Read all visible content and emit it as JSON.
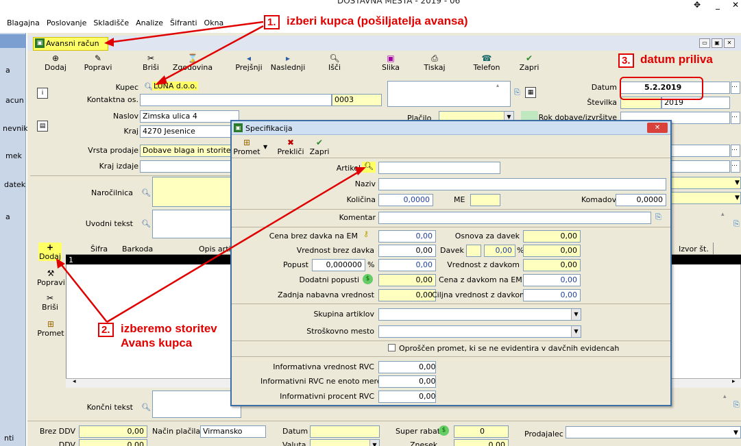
{
  "window_title": "DOSTAVNA MESTA - 2019 - 06",
  "menu": [
    "Blagajna",
    "Poslovanje",
    "Skladišče",
    "Analize",
    "Šifranti",
    "Okna"
  ],
  "left_sidebar": [
    "a",
    "acun",
    "nevnik",
    "mek",
    "datek",
    "a",
    "nti"
  ],
  "doc_title": "Avansni račun",
  "toolbar": [
    "Dodaj",
    "Popravi",
    "Briši",
    "Zgodovina",
    "Prejšnji",
    "Naslednji",
    "Išči",
    "Slika",
    "Tiskaj",
    "Telefon",
    "Zapri"
  ],
  "header": {
    "kupec_label": "Kupec",
    "kupec_value": "LUNA d.o.o.",
    "kontakt_label": "Kontaktna os.",
    "kontakt_code": "0003",
    "naslov_label": "Naslov",
    "naslov_value": "Zimska ulica 4",
    "kraj_label": "Kraj",
    "kraj_value": "4270 Jesenice",
    "vrsta_label": "Vrsta prodaje",
    "vrsta_value": "Dobave blaga in storitev",
    "kraj_izdaje_label": "Kraj izdaje",
    "narocilnica_label": "Naročilnica",
    "uvodni_label": "Uvodni tekst",
    "placilo_label": "Plačilo",
    "datum_label": "Datum",
    "datum_value": "5.2.2019",
    "stevilka_label": "Številka",
    "stevilka_value": "2019",
    "rok_label": "Rok dobave/izvršitve"
  },
  "grid": {
    "columns": [
      "Šifra",
      "Barkoda",
      "Opis arti",
      "Izvor št."
    ],
    "row_num": "1"
  },
  "side_buttons": [
    "Dodaj",
    "Popravi",
    "Briši",
    "Promet"
  ],
  "footer": {
    "koncni_label": "Končni tekst",
    "brez_ddv_label": "Brez DDV",
    "brez_ddv_value": "0,00",
    "ddv_label": "DDV",
    "ddv_value": "0,00",
    "nacin_label": "Način plačila",
    "nacin_value": "Virmansko",
    "datum_label": "Datum",
    "valuta_label": "Valuta",
    "super_label": "Super rabat",
    "super_value": "0",
    "znesek_label": "Znesek",
    "znesek_value": "0,00",
    "prodajalec_label": "Prodajalec"
  },
  "dialog": {
    "title": "Specifikacija",
    "toolbar": [
      "Promet",
      "Prekliči",
      "Zapri"
    ],
    "artikel_label": "Artikel",
    "naziv_label": "Naziv",
    "kolicina_label": "Količina",
    "kolicina_value": "0,0000",
    "me_label": "ME",
    "komadov_label": "Komadov",
    "komadov_value": "0,0000",
    "komentar_label": "Komentar",
    "cena_brez_label": "Cena brez davka na EM",
    "cena_brez_value": "0,00",
    "osnova_label": "Osnova za davek",
    "osnova_value": "0,00",
    "vrednost_brez_label": "Vrednost brez davka",
    "vrednost_brez_value": "0,00",
    "davek_label": "Davek",
    "davek_value": "0,00",
    "pct": "%",
    "davek_amount": "0,00",
    "popust_label": "Popust",
    "popust_value": "0,000000",
    "popust_amount": "0,00",
    "vrednost_z_label": "Vrednost z davkom",
    "vrednost_z_value": "0,00",
    "dodatni_label": "Dodatni popusti",
    "dodatni_value": "0,00",
    "cena_z_label": "Cena z davkom na EM",
    "cena_z_value": "0,00",
    "zadnja_label": "Zadnja nabavna vrednost",
    "zadnja_value": "0,00",
    "ciljna_label": "Ciljna vrednost z davkom",
    "ciljna_value": "0,00",
    "skupina_label": "Skupina artiklov",
    "strosek_label": "Stroškovno mesto",
    "oproscen_label": "Oproščen promet, ki se ne evidentira v davčnih evidencah",
    "rvc1_label": "Informativna vrednost RVC",
    "rvc1_value": "0,00",
    "rvc2_label": "Informativni RVC ne enoto mere",
    "rvc2_value": "0,00",
    "rvc3_label": "Informativni procent RVC",
    "rvc3_value": "0,00"
  },
  "annotations": {
    "a1_num": "1.",
    "a1_text": "izberi kupca (pošiljatelja avansa)",
    "a2_num": "2.",
    "a2_text": "izberemo storitev",
    "a2_text2": "Avans kupca",
    "a3_num": "3.",
    "a3_text": "datum priliva"
  }
}
